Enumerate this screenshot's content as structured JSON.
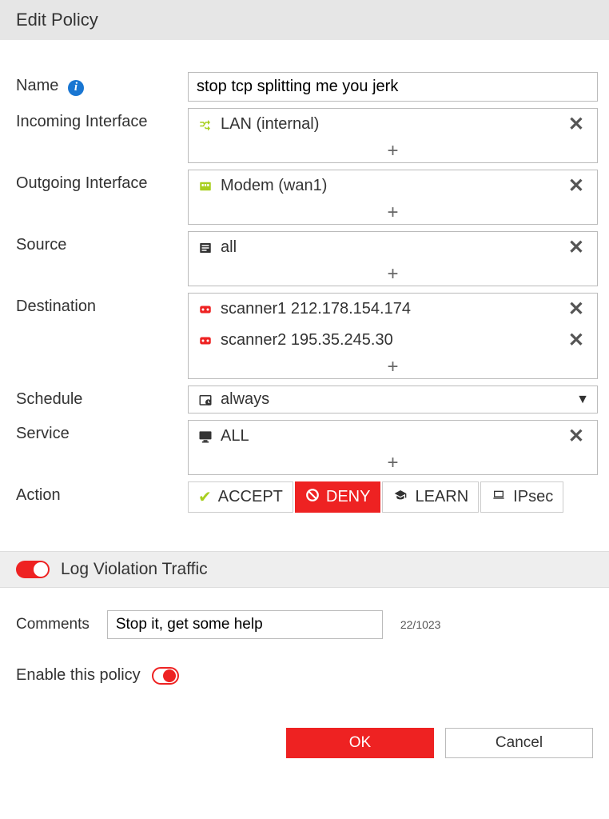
{
  "header": {
    "title": "Edit Policy"
  },
  "form": {
    "name_label": "Name",
    "name_value": "stop tcp splitting me you jerk",
    "incoming_label": "Incoming Interface",
    "incoming_items": [
      {
        "icon": "shuffle-icon",
        "text": "LAN (internal)"
      }
    ],
    "outgoing_label": "Outgoing Interface",
    "outgoing_items": [
      {
        "icon": "port-icon",
        "text": "Modem (wan1)"
      }
    ],
    "source_label": "Source",
    "source_items": [
      {
        "icon": "address-icon",
        "text": "all"
      }
    ],
    "destination_label": "Destination",
    "destination_items": [
      {
        "icon": "device-icon",
        "text": "scanner1 212.178.154.174"
      },
      {
        "icon": "device-icon",
        "text": "scanner2 195.35.245.30"
      }
    ],
    "schedule_label": "Schedule",
    "schedule_value": "always",
    "service_label": "Service",
    "service_items": [
      {
        "icon": "monitor-icon",
        "text": "ALL"
      }
    ],
    "action_label": "Action",
    "actions": {
      "accept": "ACCEPT",
      "deny": "DENY",
      "learn": "LEARN",
      "ipsec": "IPsec",
      "selected": "deny"
    }
  },
  "log_section": {
    "label": "Log Violation Traffic",
    "enabled": true
  },
  "comments": {
    "label": "Comments",
    "value": "Stop it, get some help",
    "counter": "22/1023"
  },
  "enable": {
    "label": "Enable this policy",
    "enabled": true
  },
  "footer": {
    "ok": "OK",
    "cancel": "Cancel"
  }
}
